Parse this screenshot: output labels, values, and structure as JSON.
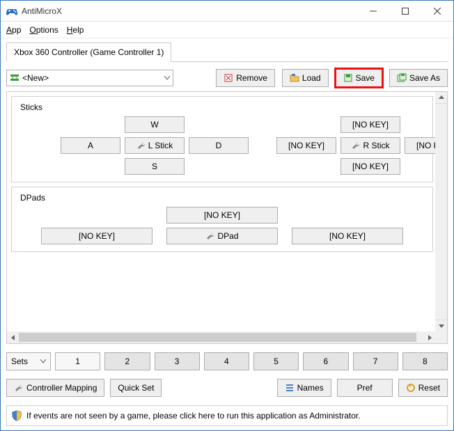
{
  "window": {
    "title": "AntiMicroX"
  },
  "menu": {
    "app": "App",
    "options": "Options",
    "help": "Help"
  },
  "tab": {
    "label": "Xbox 360 Controller (Game Controller 1)"
  },
  "profile": {
    "selected": "<New>"
  },
  "toolbar": {
    "remove": "Remove",
    "load": "Load",
    "save": "Save",
    "saveas": "Save As"
  },
  "sticks": {
    "legend": "Sticks",
    "left": {
      "up": "W",
      "left": "A",
      "center": "L Stick",
      "right": "D",
      "down": "S"
    },
    "right": {
      "up": "[NO KEY]",
      "left": "[NO KEY]",
      "center": "R Stick",
      "right": "[NO KEY]",
      "down": "[NO KEY]"
    }
  },
  "dpads": {
    "legend": "DPads",
    "up": "[NO KEY]",
    "left": "[NO KEY]",
    "center": "DPad",
    "right": "[NO KEY]"
  },
  "sets": {
    "label": "Sets",
    "b1": "1",
    "b2": "2",
    "b3": "3",
    "b4": "4",
    "b5": "5",
    "b6": "6",
    "b7": "7",
    "b8": "8"
  },
  "bottom": {
    "mapping": "Controller Mapping",
    "quickset": "Quick Set",
    "names": "Names",
    "pref": "Pref",
    "reset": "Reset"
  },
  "admin": {
    "text": "If events are not seen by a game, please click here to run this application as Administrator."
  }
}
